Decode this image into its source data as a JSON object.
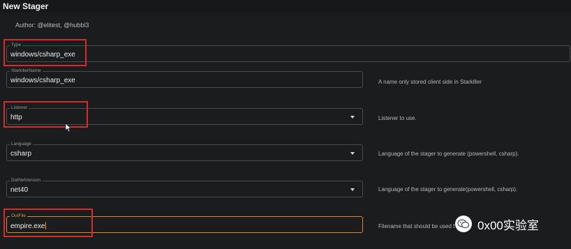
{
  "app": {
    "title": "New Stager"
  },
  "author": "Author: @elitest, @hubbl3",
  "fields": {
    "type": {
      "label": "Type",
      "value": "windows/csharp_exe"
    },
    "starkiller_name": {
      "label": "StarkillerName",
      "value": "windows/csharp_exe",
      "hint": "A name only stored client side in Starkiller"
    },
    "listener": {
      "label": "Listener",
      "value": "http",
      "hint": "Listener to use."
    },
    "language": {
      "label": "Language",
      "value": "csharp",
      "hint": "Language of the stager to generate (powershell, csharp)."
    },
    "dotnet_version": {
      "label": "DotNetVersion",
      "value": "net40",
      "hint": "Language of the stager to generate(powershell, csharp)."
    },
    "outfile": {
      "label": "OutFile",
      "value": "empire.exe",
      "hint": "Filename that should be used f"
    }
  },
  "watermark": {
    "text": "0x00实验室",
    "icon": "wechat-icon"
  },
  "colors": {
    "highlight_box": "#d92b2b",
    "focus_accent": "#e0952f",
    "background": "#1b1c1e"
  }
}
